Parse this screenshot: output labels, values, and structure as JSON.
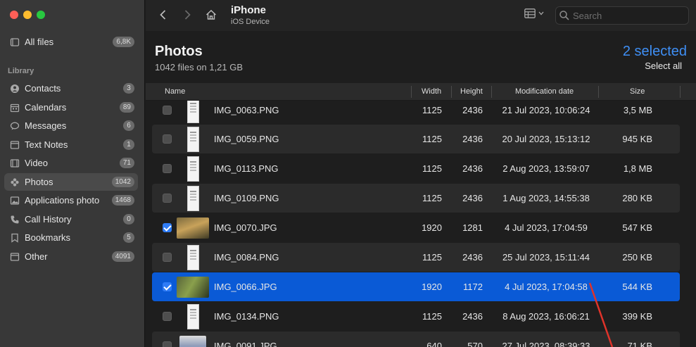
{
  "window": {
    "title": "iPhone",
    "subtitle": "iOS Device"
  },
  "sidebar": {
    "all_files": {
      "label": "All files",
      "badge": "6,8K",
      "icon": "folder-icon"
    },
    "section_label": "Library",
    "items": [
      {
        "label": "Contacts",
        "badge": "3",
        "icon": "contacts-icon"
      },
      {
        "label": "Calendars",
        "badge": "89",
        "icon": "calendar-icon"
      },
      {
        "label": "Messages",
        "badge": "6",
        "icon": "message-icon"
      },
      {
        "label": "Text Notes",
        "badge": "1",
        "icon": "note-icon"
      },
      {
        "label": "Video",
        "badge": "71",
        "icon": "video-icon"
      },
      {
        "label": "Photos",
        "badge": "1042",
        "icon": "photos-icon",
        "active": true
      },
      {
        "label": "Applications photo",
        "badge": "1468",
        "icon": "app-photo-icon"
      },
      {
        "label": "Call History",
        "badge": "0",
        "icon": "phone-icon"
      },
      {
        "label": "Bookmarks",
        "badge": "5",
        "icon": "bookmark-icon"
      },
      {
        "label": "Other",
        "badge": "4091",
        "icon": "other-icon"
      }
    ]
  },
  "search": {
    "placeholder": "Search"
  },
  "header": {
    "title": "Photos",
    "subtitle": "1042 files on 1,21 GB",
    "selected": "2 selected",
    "select_all": "Select all"
  },
  "columns": {
    "name": "Name",
    "width": "Width",
    "height": "Height",
    "date": "Modification date",
    "size": "Size"
  },
  "rows": [
    {
      "name": "IMG_0063.PNG",
      "width": "1125",
      "height": "2436",
      "date": "21 Jul 2023, 10:06:24",
      "size": "3,5 MB",
      "checked": false,
      "thumb": "png"
    },
    {
      "name": "IMG_0059.PNG",
      "width": "1125",
      "height": "2436",
      "date": "20 Jul 2023, 15:13:12",
      "size": "945 KB",
      "checked": false,
      "thumb": "png"
    },
    {
      "name": "IMG_0113.PNG",
      "width": "1125",
      "height": "2436",
      "date": "2 Aug 2023, 13:59:07",
      "size": "1,8 MB",
      "checked": false,
      "thumb": "png"
    },
    {
      "name": "IMG_0109.PNG",
      "width": "1125",
      "height": "2436",
      "date": "1 Aug 2023, 14:55:38",
      "size": "280 KB",
      "checked": false,
      "thumb": "png"
    },
    {
      "name": "IMG_0070.JPG",
      "width": "1920",
      "height": "1281",
      "date": "4 Jul 2023, 17:04:59",
      "size": "547 KB",
      "checked": true,
      "thumb": "duck"
    },
    {
      "name": "IMG_0084.PNG",
      "width": "1125",
      "height": "2436",
      "date": "25 Jul 2023, 15:11:44",
      "size": "250 KB",
      "checked": false,
      "thumb": "png"
    },
    {
      "name": "IMG_0066.JPG",
      "width": "1920",
      "height": "1172",
      "date": "4 Jul 2023, 17:04:58",
      "size": "544 KB",
      "checked": true,
      "thumb": "cat",
      "highlighted": true
    },
    {
      "name": "IMG_0134.PNG",
      "width": "1125",
      "height": "2436",
      "date": "8 Aug 2023, 16:06:21",
      "size": "399 KB",
      "checked": false,
      "thumb": "png"
    },
    {
      "name": "IMG_0091.JPG",
      "width": "640",
      "height": "570",
      "date": "27 Jul 2023, 08:39:33",
      "size": "71 KB",
      "checked": false,
      "thumb": "doc"
    }
  ],
  "colors": {
    "accent": "#3f8ff5",
    "selection": "#0a5ad6",
    "annotation_arrow": "#e0332a"
  }
}
